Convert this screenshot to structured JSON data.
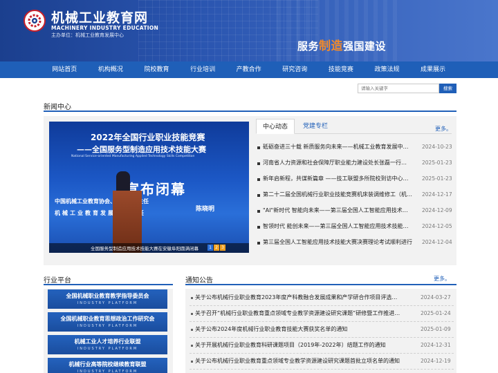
{
  "header": {
    "title": "机械工业教育网",
    "title_en": "MACHINERY INDUSTRY EDUCATION",
    "host": "主办单位：机械工业教育发展中心",
    "slogan_a": "服务",
    "slogan_b": "制造",
    "slogan_c": "强国建设",
    "logo_icon": "gear-logo-icon"
  },
  "nav": {
    "items": [
      "网站首页",
      "机构概况",
      "院校教育",
      "行业培训",
      "产教合作",
      "研究咨询",
      "技能竞赛",
      "政策法规",
      "成果展示"
    ]
  },
  "search": {
    "placeholder": "请输入关键字",
    "button": "搜索"
  },
  "news": {
    "section_title": "新闻中心",
    "slide": {
      "title1": "2022年全国行业职业技能竞赛",
      "title2": "——全国服务型制造应用技术技能大赛",
      "title_en": "National Service-oriented Manufacturing Applied Technology Skills Competition",
      "big": "宣布闭幕",
      "line1": "中国机械工业教育协会、…培训部主任",
      "line2": "机械工业教育发展中心主任",
      "name": "陈晓明",
      "caption": "全国服务型制造应用技术技能大赛在安徽阜阳圆满闭幕",
      "pages": [
        "1",
        "2",
        "3"
      ],
      "active_page": "1"
    },
    "tabs": [
      "中心动态",
      "党建专栏"
    ],
    "more": "更多。",
    "items": [
      {
        "title": "砥砺奋进三十载 新质服务向未来——机械工业教育发展中…",
        "date": "2024-10-23"
      },
      {
        "title": "河南省人力资源和社会保障厅职业能力建设处长张磊一行…",
        "date": "2025-01-23"
      },
      {
        "title": "新年启新程，共谋新篇章 ——技工联盟多所院校到访中心开…",
        "date": "2025-01-23"
      },
      {
        "title": "第二十二届全国机械行业职业技能竞赛机床装调维修工（机…",
        "date": "2024-12-17"
      },
      {
        "title": "\"AI\"新时代 智能向未来——第三届全国人工智能应用技术技…",
        "date": "2024-12-09"
      },
      {
        "title": "智领时代 能创未来——第三届全国人工智能应用技术技能大…",
        "date": "2024-12-05"
      },
      {
        "title": "第三届全国人工智能应用技术技能大赛决赛理论考试顺利进行",
        "date": "2024-12-04"
      }
    ]
  },
  "platform": {
    "section_title": "行业平台",
    "en": "INDUSTRY PLATFORM",
    "items": [
      "全国机械职业教育教学指导委员会",
      "全国机械职业教育思想政治工作研究会",
      "机械工业人才培养行业联盟",
      "机械行业高等院校继续教育联盟"
    ]
  },
  "notice": {
    "section_title": "通知公告",
    "more": "更多。",
    "items": [
      {
        "title": "关于公布机械行业职业教育2023年度产科教融合发展成果和产学研合作项目评选…",
        "date": "2024-03-27"
      },
      {
        "title": "关于召开“机械行业职业教育重点领域专业教学资源建设研究课题”研修暨工作推进…",
        "date": "2025-01-24"
      },
      {
        "title": "关于公布2024年度机械行业职业教育技能大赛获奖名单的通知",
        "date": "2025-01-09"
      },
      {
        "title": "关于开展机械行业职业教育科研课题项目（2019年-2022年）结题工作的通知",
        "date": "2024-12-31"
      },
      {
        "title": "关于公布机械行业职业教育重点领域专业教学资源建设研究课题首批立项名单的通知",
        "date": "2024-12-19"
      }
    ]
  },
  "colors": {
    "primary": "#1f5fb8",
    "accent": "#f08a2c",
    "header_dark": "#1b3f8e"
  }
}
